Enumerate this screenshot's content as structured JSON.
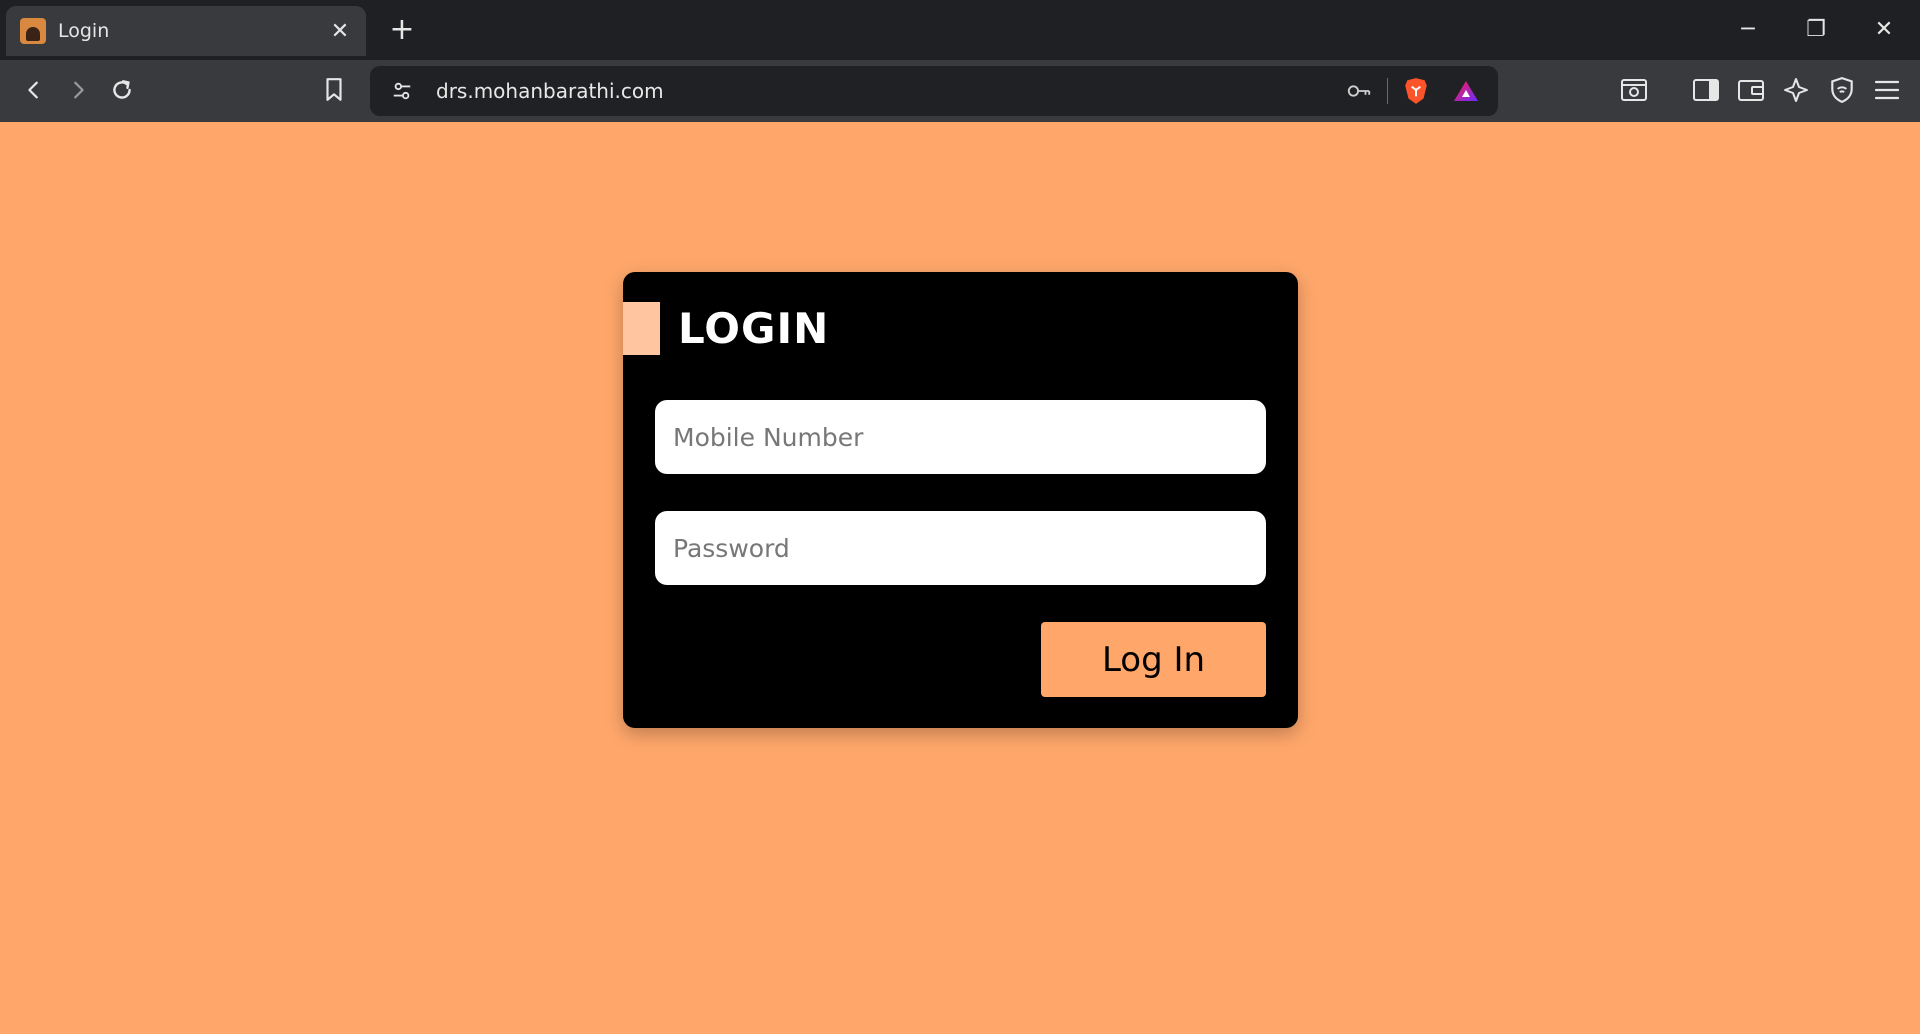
{
  "browser": {
    "tab_title": "Login",
    "tab_close": "✕",
    "new_tab": "+",
    "url": "drs.mohanbarathi.com",
    "window_controls": {
      "minimize": "─",
      "restore": "❐",
      "close": "✕"
    },
    "icons": {
      "back": "chevron-left-icon",
      "forward": "chevron-right-icon",
      "reload": "reload-icon",
      "bookmark": "bookmark-icon",
      "site_settings": "tune-icon",
      "password_key": "key-icon",
      "brave_shields": "brave-lion-icon",
      "brave_rewards": "triangle-icon",
      "screenshot": "screenshot-icon",
      "sidebar": "sidebar-icon",
      "wallet": "wallet-icon",
      "leo": "sparkle-icon",
      "vpn": "shield-icon",
      "menu": "hamburger-icon"
    },
    "colors": {
      "chrome": "#1f2023",
      "tab": "#393a3e",
      "urlbar": "#202124",
      "brave": "#fb542b"
    }
  },
  "login": {
    "title": "LOGIN",
    "mobile_placeholder": "Mobile Number",
    "password_placeholder": "Password",
    "submit_label": "Log In",
    "colors": {
      "page_bg": "#ffa76b",
      "card_bg": "#000000",
      "accent": "#ffc4a0",
      "button_bg": "#ffa76b"
    }
  }
}
